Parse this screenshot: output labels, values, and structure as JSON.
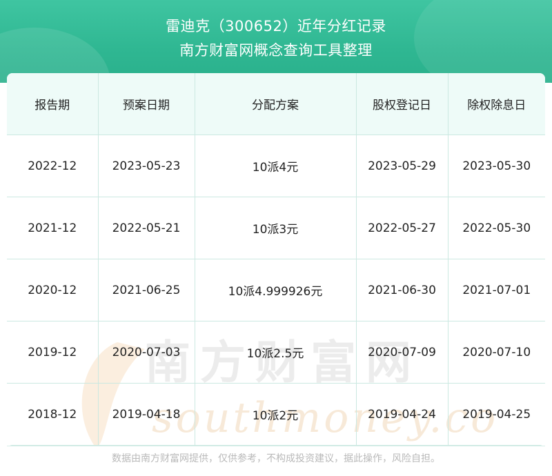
{
  "header": {
    "title": "雷迪克（300652）近年分红记录",
    "subtitle": "南方财富网概念查询工具整理"
  },
  "table": {
    "columns": [
      "报告期",
      "预案日期",
      "分配方案",
      "股权登记日",
      "除权除息日"
    ],
    "rows": [
      [
        "2022-12",
        "2023-05-23",
        "10派4元",
        "2023-05-29",
        "2023-05-30"
      ],
      [
        "2021-12",
        "2022-05-21",
        "10派3元",
        "2022-05-27",
        "2022-05-30"
      ],
      [
        "2020-12",
        "2021-06-25",
        "10派4.999926元",
        "2021-06-30",
        "2021-07-01"
      ],
      [
        "2019-12",
        "2020-07-03",
        "10派2.5元",
        "2020-07-09",
        "2020-07-10"
      ],
      [
        "2018-12",
        "2019-04-18",
        "10派2元",
        "2019-04-24",
        "2019-04-25"
      ]
    ]
  },
  "watermark": {
    "cn": "南方财富网",
    "en": "southmoney.com"
  },
  "footer": {
    "disclaimer": "数据由南方财富网提供，仅供参考，不构成投资建议，据此操作，风险自担。"
  },
  "colors": {
    "header_green": "#2fb792",
    "header_row_bg": "#eefbf8",
    "grid_line": "#cbe8e1"
  }
}
